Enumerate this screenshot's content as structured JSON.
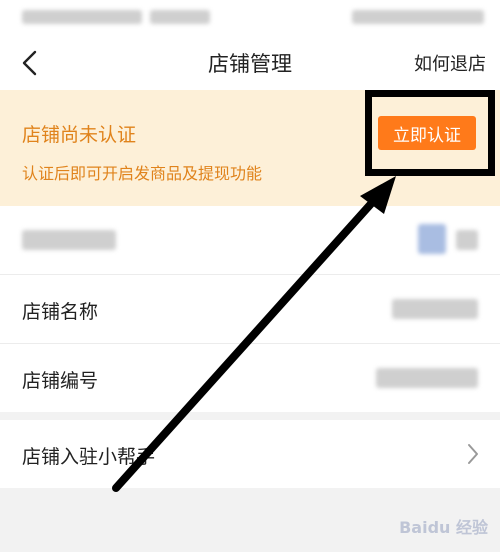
{
  "nav": {
    "title": "店铺管理",
    "action": "如何退店"
  },
  "banner": {
    "title": "店铺尚未认证",
    "subtitle": "认证后即可开启发商品及提现功能",
    "button": "立即认证"
  },
  "list": {
    "rows": [
      {
        "label": "店铺名称"
      },
      {
        "label": "店铺编号"
      }
    ],
    "helper": "店铺入驻小帮手"
  },
  "colors": {
    "accent": "#ff7a1a",
    "banner_bg": "#fdf0d8",
    "banner_text": "#e0831c"
  },
  "icons": [
    "back-icon",
    "chevron-right-icon",
    "arrow-pointer"
  ]
}
